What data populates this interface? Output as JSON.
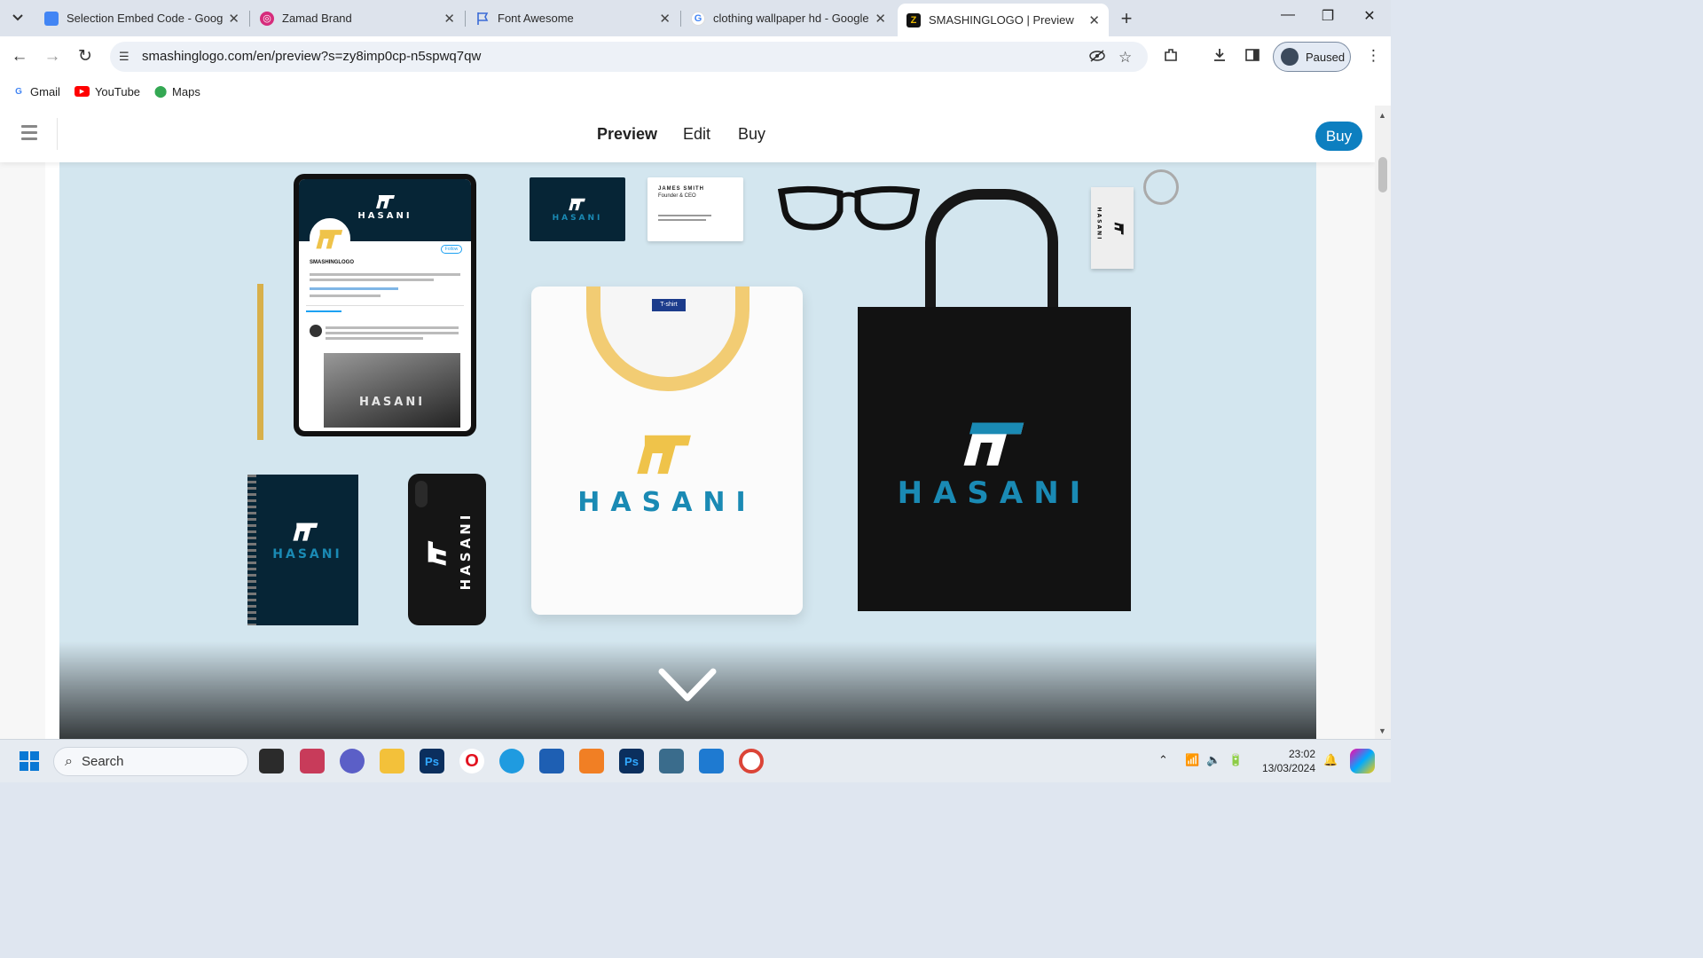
{
  "browser": {
    "tabs": [
      {
        "title": "Selection Embed Code - Google",
        "favicon": "google-sites-icon",
        "color": "#4285f4"
      },
      {
        "title": "Zamad Brand",
        "favicon": "canva-icon",
        "color": "#d62c7c"
      },
      {
        "title": "Font Awesome",
        "favicon": "flag-icon",
        "color": "#3b6bd6"
      },
      {
        "title": "clothing wallpaper hd - Google",
        "favicon": "google-icon",
        "color": "#4285f4"
      },
      {
        "title": "SMASHINGLOGO | Preview",
        "favicon": "smashinglogo-icon",
        "color": "#e6b800"
      }
    ],
    "url": "smashinglogo.com/en/preview?s=zy8imp0cp-n5spwq7qw",
    "profile_label": "Paused",
    "bookmarks": [
      {
        "label": "Gmail",
        "icon": "google-icon"
      },
      {
        "label": "YouTube",
        "icon": "youtube-icon"
      },
      {
        "label": "Maps",
        "icon": "maps-icon"
      }
    ]
  },
  "site": {
    "nav": [
      "Preview",
      "Edit",
      "Buy"
    ],
    "active_nav": "Preview",
    "buy_button": "Buy"
  },
  "mockup": {
    "brand_name": "HASANI",
    "profile_handle": "SMASHINGLOGO",
    "card_name": "JAMES SMITH",
    "card_title": "Founder & CEO",
    "shirt_tag": "T-shirt",
    "colors": {
      "background": "#d3e6ef",
      "navy": "#062536",
      "brand_blue": "#1a8ab4",
      "logo_yellow": "#efc34a"
    }
  },
  "taskbar": {
    "search_placeholder": "Search",
    "time": "23:02",
    "date": "13/03/2024"
  }
}
